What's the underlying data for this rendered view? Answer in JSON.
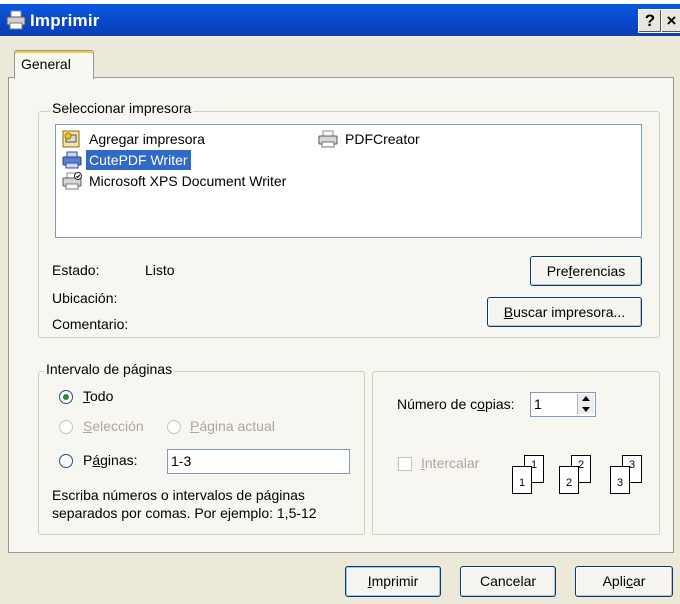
{
  "window": {
    "title": "Imprimir",
    "help_glyph": "?",
    "close_glyph": "×"
  },
  "tabs": [
    {
      "label": "General",
      "active": true
    }
  ],
  "select_printer": {
    "legend": "Seleccionar impresora",
    "printers": [
      {
        "name": "Agregar impresora",
        "icon": "add-printer-icon",
        "selected": false
      },
      {
        "name": "PDFCreator",
        "icon": "printer-icon",
        "selected": false
      },
      {
        "name": "CutePDF Writer",
        "icon": "printer-icon",
        "selected": true
      },
      {
        "name": "Microsoft XPS Document Writer",
        "icon": "default-printer-icon",
        "selected": false
      }
    ],
    "status_label": "Estado:",
    "status_value": "Listo",
    "location_label": "Ubicación:",
    "location_value": "",
    "comment_label": "Comentario:",
    "comment_value": "",
    "preferences_button": {
      "pre": "Pre",
      "mnemonic": "f",
      "post": "erencias"
    },
    "find_printer_button": {
      "pre": "",
      "mnemonic": "B",
      "post": "uscar impresora..."
    }
  },
  "page_range": {
    "legend": "Intervalo de páginas",
    "all": {
      "pre": "",
      "mnemonic": "T",
      "post": "odo",
      "checked": true
    },
    "selection": {
      "pre": "",
      "mnemonic": "S",
      "post": "elección",
      "enabled": false
    },
    "current_page": {
      "pre": "",
      "mnemonic": "P",
      "post": "ágina actual",
      "enabled": false
    },
    "pages": {
      "pre": "P",
      "mnemonic": "á",
      "post": "ginas:",
      "value": "1-3"
    },
    "hint_line1": "Escriba números o intervalos de páginas",
    "hint_line2": "separados por comas. Por ejemplo: 1,5-12"
  },
  "copies": {
    "label": {
      "pre": "Número de c",
      "mnemonic": "o",
      "post": "pias:"
    },
    "value": "1",
    "collate": {
      "pre": "",
      "mnemonic": "I",
      "post": "ntercalar",
      "enabled": false,
      "checked": false
    },
    "collate_pages": [
      "1",
      "1",
      "2",
      "2",
      "3",
      "3"
    ]
  },
  "buttons": {
    "print": {
      "pre": "",
      "mnemonic": "I",
      "post": "mprimir"
    },
    "cancel": "Cancelar",
    "apply": {
      "pre": "Apli",
      "mnemonic": "c",
      "post": "ar"
    }
  }
}
